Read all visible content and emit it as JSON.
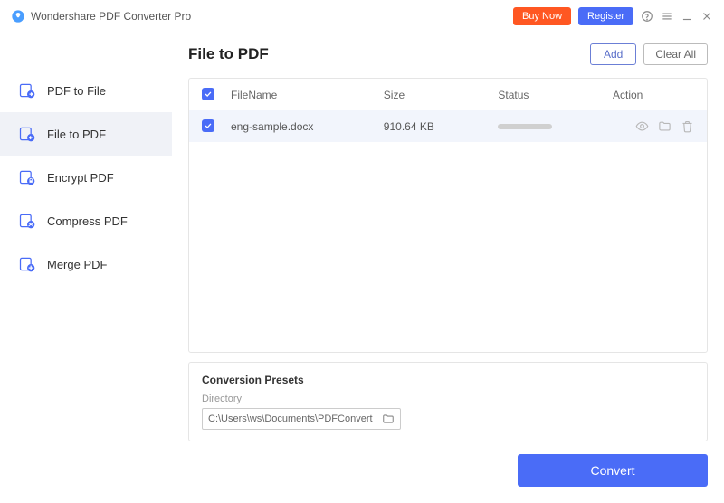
{
  "titlebar": {
    "app_name": "Wondershare PDF Converter Pro",
    "buy": "Buy Now",
    "register": "Register"
  },
  "sidebar": {
    "items": [
      {
        "label": "PDF to File"
      },
      {
        "label": "File to PDF"
      },
      {
        "label": "Encrypt PDF"
      },
      {
        "label": "Compress PDF"
      },
      {
        "label": "Merge PDF"
      }
    ]
  },
  "header": {
    "title": "File to PDF",
    "add": "Add",
    "clear": "Clear All"
  },
  "table": {
    "cols": {
      "name": "FileName",
      "size": "Size",
      "status": "Status",
      "action": "Action"
    },
    "rows": [
      {
        "name": "eng-sample.docx",
        "size": "910.64 KB"
      }
    ]
  },
  "presets": {
    "title": "Conversion Presets",
    "dir_label": "Directory",
    "dir_value": "C:\\Users\\ws\\Documents\\PDFConvert"
  },
  "convert": "Convert"
}
